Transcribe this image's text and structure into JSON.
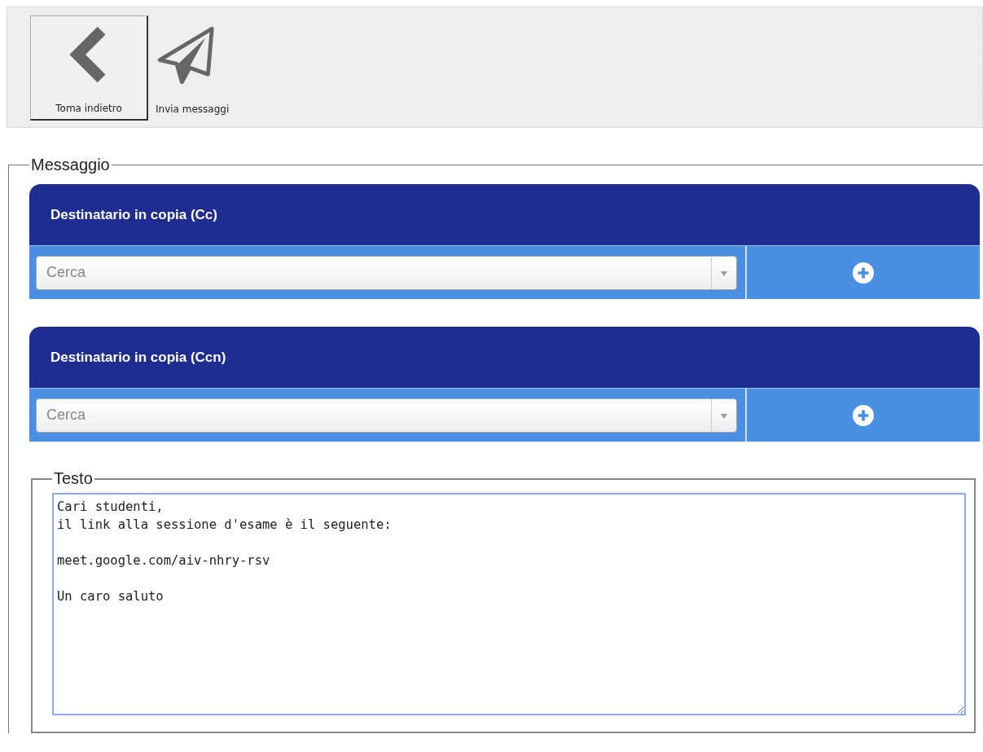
{
  "toolbar": [
    {
      "kind": "back",
      "label": "Toma indietro",
      "selected": true
    },
    {
      "kind": "send",
      "label": "Invia messaggi",
      "selected": false
    }
  ],
  "message": {
    "legend": "Messaggio",
    "recipients": [
      {
        "title": "Destinatario in copia (Cc)",
        "placeholder": "Cerca"
      },
      {
        "title": "Destinatario in copia (Ccn)",
        "placeholder": "Cerca"
      }
    ],
    "text": {
      "legend": "Testo",
      "value": "Cari studenti,\nil link alla sessione d'esame è il seguente:\n\nmeet.google.com/aiv-nhry-rsv\n\nUn caro saluto"
    }
  }
}
